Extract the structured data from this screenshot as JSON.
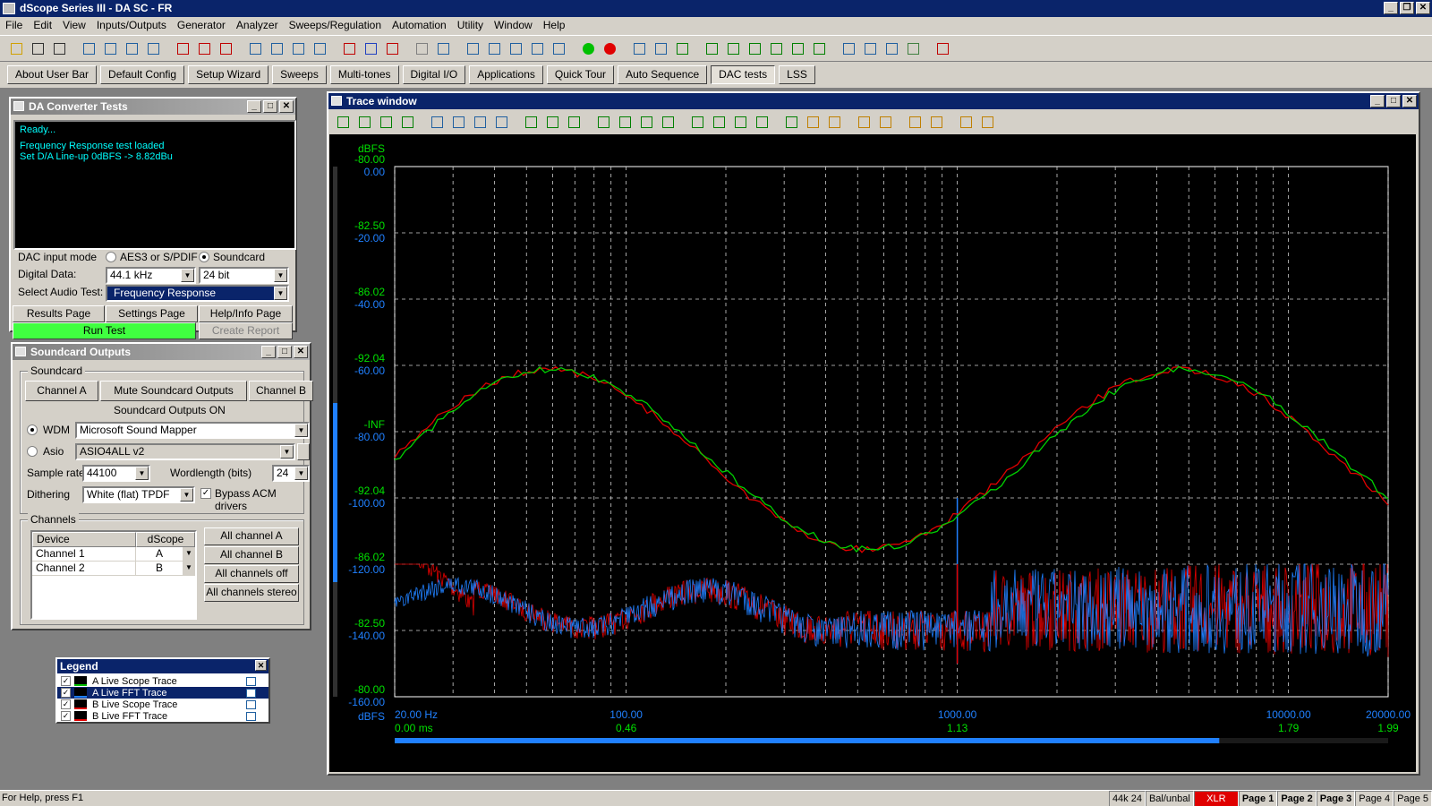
{
  "app": {
    "title": "dScope Series III - DA SC - FR"
  },
  "menu": [
    "File",
    "Edit",
    "View",
    "Inputs/Outputs",
    "Generator",
    "Analyzer",
    "Sweeps/Regulation",
    "Automation",
    "Utility",
    "Window",
    "Help"
  ],
  "userbar": [
    "About User Bar",
    "Default Config",
    "Setup Wizard",
    "Sweeps",
    "Multi-tones",
    "Digital I/O",
    "Applications",
    "Quick Tour",
    "Auto Sequence",
    "DAC tests",
    "LSS"
  ],
  "dac": {
    "title": "DA Converter Tests",
    "log": [
      "Ready...",
      "Frequency Response test loaded",
      "Set D/A Line-up 0dBFS -> 8.82dBu"
    ],
    "input_mode_label": "DAC input mode",
    "opt_aes": "AES3 or S/PDIF",
    "opt_soundcard": "Soundcard",
    "digital_data_label": "Digital Data:",
    "sample_rate": "44.1 kHz",
    "bits": "24 bit",
    "select_test_label": "Select Audio Test:",
    "test": "Frequency Response",
    "results": "Results Page",
    "settings": "Settings Page",
    "help": "Help/Info Page",
    "run": "Run Test",
    "report": "Create Report"
  },
  "sc": {
    "title": "Soundcard Outputs",
    "group": "Soundcard",
    "chA": "Channel A",
    "mute": "Mute Soundcard Outputs",
    "chB": "Channel B",
    "status": "Soundcard Outputs ON",
    "wdm": "WDM",
    "wdm_dev": "Microsoft Sound Mapper",
    "asio": "Asio",
    "asio_dev": "ASIO4ALL v2",
    "sr_label": "Sample rate",
    "sr": "44100",
    "wl_label": "Wordlength (bits)",
    "wl": "24",
    "dith_label": "Dithering",
    "dith": "White (flat) TPDF",
    "bypass": "Bypass ACM drivers",
    "channels": "Channels",
    "col_device": "Device",
    "col_dscope": "dScope",
    "rows": [
      {
        "dev": "Channel 1",
        "ds": "A"
      },
      {
        "dev": "Channel 2",
        "ds": "B"
      }
    ],
    "allA": "All channel A",
    "allB": "All channel B",
    "alloff": "All channels off",
    "allstereo": "All channels stereo"
  },
  "legend": {
    "title": "Legend",
    "items": [
      {
        "label": "A  Live Scope Trace",
        "color": "#00c000",
        "sel": false
      },
      {
        "label": "A  Live FFT Trace",
        "color": "#2080ff",
        "sel": true
      },
      {
        "label": "B  Live Scope Trace",
        "color": "#e00000",
        "sel": false
      },
      {
        "label": "B  Live FFT Trace",
        "color": "#e00000",
        "sel": false
      }
    ]
  },
  "trace": {
    "title": "Trace window"
  },
  "chart_data": {
    "type": "line",
    "left_axis_green": {
      "unit": "dBFS",
      "ticks": [
        "-80.00",
        "-82.50",
        "-86.02",
        "-92.04",
        "-INF",
        "-92.04",
        "-86.02",
        "-82.50",
        "-80.00"
      ]
    },
    "left_axis_blue": {
      "ticks": [
        "0.00",
        "-20.00",
        "-40.00",
        "-60.00",
        "-80.00",
        "-100.00",
        "-120.00",
        "-140.00",
        "-160.00"
      ],
      "ylim": [
        -160,
        0
      ],
      "unit": "dBFS"
    },
    "x_freq": {
      "ticks": [
        "20.00 Hz",
        "100.00",
        "1000.00",
        "10000.00",
        "20000.00"
      ],
      "xlim": [
        20,
        20000
      ]
    },
    "x_time": {
      "ticks": [
        "0.00 ms",
        "0.46",
        "1.13",
        "1.79",
        "1.99"
      ]
    },
    "series": [
      {
        "name": "A  Live Scope Trace",
        "color": "#00d000",
        "kind": "scope"
      },
      {
        "name": "B  Live Scope Trace",
        "color": "#e00000",
        "kind": "scope"
      },
      {
        "name": "A  Live FFT Trace",
        "color": "#2080ff",
        "kind": "fft",
        "peak": {
          "x": 1000,
          "y": -100
        }
      },
      {
        "name": "B  Live FFT Trace",
        "color": "#e00000",
        "kind": "fft",
        "peak": {
          "x": 1000,
          "y": -120
        }
      }
    ],
    "grid": true
  },
  "status": {
    "help": "For Help, press F1",
    "items": [
      "44k 24",
      "Bal/unbal",
      "XLR",
      "Page 1",
      "Page 2",
      "Page 3",
      "Page 4",
      "Page 5"
    ]
  }
}
